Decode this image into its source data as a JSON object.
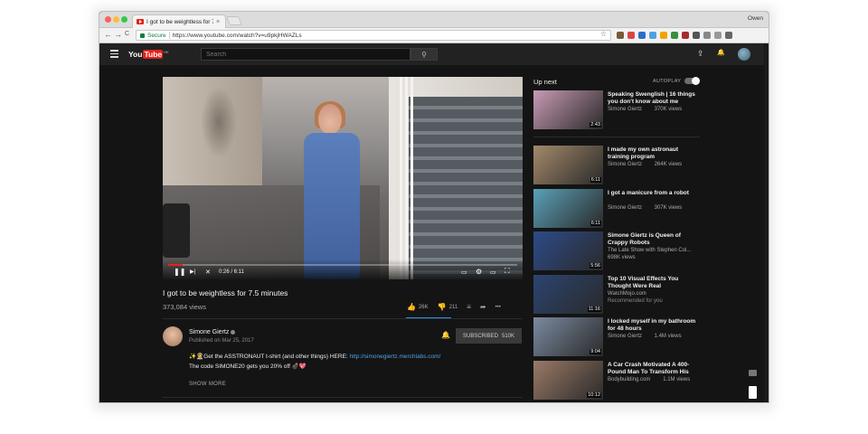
{
  "browser": {
    "tab_title": "I got to be weightless for 7.5",
    "tab_close": "×",
    "profile": "Owen",
    "secure_label": "Secure",
    "url": "https://www.youtube.com/watch?v=u9pkjHWAZLs",
    "nav_back": "←",
    "nav_forward": "→",
    "nav_reload": "C",
    "bookmark": "☆",
    "extension_colors": [
      "#7b5a3a",
      "#d44",
      "#2a6ec9",
      "#4da3e0",
      "#f1a300",
      "#3a8f3a",
      "#aa2a2a",
      "#555",
      "#888",
      "#999",
      "#666"
    ]
  },
  "youtube": {
    "logo_you": "You",
    "logo_tube": "Tube",
    "logo_region": "HK",
    "search_placeholder": "Search",
    "search_icon": "⚲",
    "upload_icon": "⇪",
    "notifications_icon": "🔔"
  },
  "player": {
    "progress": 0.042,
    "time": "0:26 / 6:11",
    "play_icon": "❚❚",
    "next_icon": "▶|",
    "mute_icon": "✕",
    "cc_icon": "▭",
    "settings_icon": "⚙",
    "theater_icon": "▭",
    "fullscreen_icon": "⛶"
  },
  "video": {
    "title": "I got to be weightless for 7.5 minutes",
    "views": "373,084 views",
    "likes": "26K",
    "dislikes": "211",
    "like_icon": "👍",
    "dislike_icon": "👎",
    "playlist_icon": "≡",
    "share_icon": "➦",
    "more_icon": "•••"
  },
  "channel": {
    "name": "Simone Giertz",
    "published": "Published on Mar 25, 2017",
    "bell_icon": "🔔",
    "subscribe_label": "SUBSCRIBED",
    "subscriber_count": "510K",
    "desc_line1_prefix": "✨👩‍🚀Get the ASSTRONAUT t-shirt (and other things) HERE: ",
    "desc_line1_link": "http://simonegiertz.merchlabs.com/",
    "desc_line2": "The code SIMONE20 gets you 20% off 💣💖",
    "show_more": "SHOW MORE"
  },
  "sidebar": {
    "up_next": "Up next",
    "autoplay": "AUTOPLAY",
    "autoplay_on": true,
    "items": [
      {
        "title": "Speaking Swenglish | 16 things you don't know about me",
        "channel": "Simone Giertz",
        "views": "370K views",
        "duration": "2:43",
        "thumb_color": "#c89bb5"
      },
      {
        "title": "I made my own astronaut training program",
        "channel": "Simone Giertz",
        "views": "264K views",
        "duration": "6:11",
        "thumb_color": "#a38a6a"
      },
      {
        "title": "I got a manicure from a robot",
        "channel": "Simone Giertz",
        "views": "307K views",
        "duration": "6:11",
        "thumb_color": "#5aa1b8"
      },
      {
        "title": "Simone Giertz is Queen of Crappy Robots",
        "channel": "The Late Show with Stephen Col...",
        "views": "698K views",
        "duration": "5:56",
        "thumb_color": "#2d4b8a"
      },
      {
        "title": "Top 10 Visual Effects You Thought Were Real",
        "channel": "WatchMojo.com",
        "views": "",
        "sub": "Recommended for you",
        "duration": "11:16",
        "thumb_color": "#2b4470"
      },
      {
        "title": "I locked myself in my bathroom for 48 hours",
        "channel": "Simone Giertz",
        "views": "1.4M views",
        "duration": "9:04",
        "thumb_color": "#7b8aa0"
      },
      {
        "title": "A Car Crash Motivated A 400-Pound Man To Transform His",
        "channel": "Bodybuilding.com",
        "views": "1.1M views",
        "duration": "10:12",
        "thumb_color": "#9a7a66"
      }
    ]
  }
}
